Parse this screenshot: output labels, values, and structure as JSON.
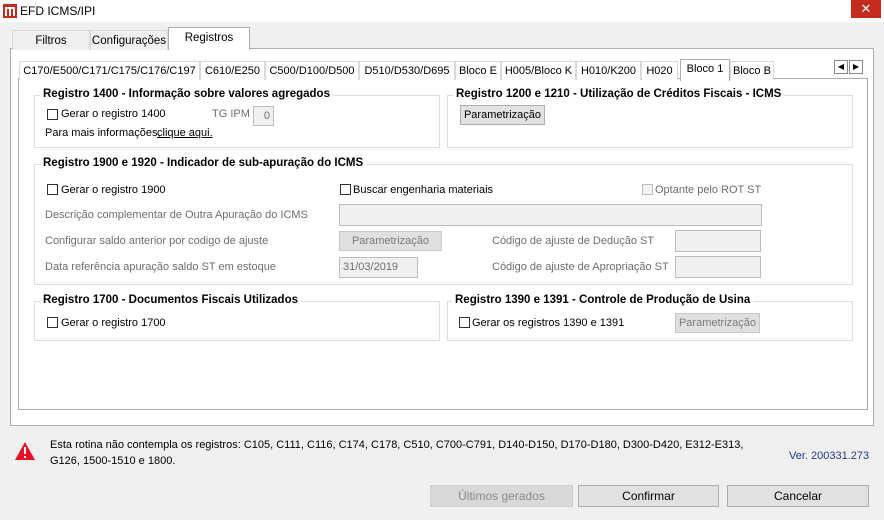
{
  "window": {
    "title": "EFD ICMS/IPI",
    "close_glyph": "✕"
  },
  "tabs": [
    {
      "label": "Filtros"
    },
    {
      "label": "Configurações"
    },
    {
      "label": "Registros"
    }
  ],
  "subtabs": [
    {
      "label": "C170/E500/C171/C175/C176/C197"
    },
    {
      "label": "C610/E250"
    },
    {
      "label": "C500/D100/D500"
    },
    {
      "label": "D510/D530/D695"
    },
    {
      "label": "Bloco E"
    },
    {
      "label": "H005/Bloco K"
    },
    {
      "label": "H010/K200"
    },
    {
      "label": "H020"
    },
    {
      "label": "Bloco 1"
    },
    {
      "label": "Bloco B"
    }
  ],
  "scroll": {
    "left": "◀",
    "right": "▶"
  },
  "g1400": {
    "title": "Registro 1400 - Informação sobre valores agregados",
    "checkbox_label": "Gerar o registro 1400",
    "tg_ipm_label": "TG IPM",
    "tg_ipm_value": "0",
    "info_prefix": "Para mais informações,",
    "info_link": "clique aqui."
  },
  "g1200": {
    "title": "Registro 1200 e 1210 - Utilização de Créditos Fiscais - ICMS",
    "button": "Parametrização"
  },
  "g1900": {
    "title": "Registro 1900 e 1920 - Indicador de sub-apuração do ICMS",
    "cb_1900": "Gerar o registro 1900",
    "cb_buscar": "Buscar engenharia materiais",
    "cb_optante": "Optante pelo ROT ST",
    "desc_label": "Descrição complementar de Outra Apuração do ICMS",
    "desc_value": "",
    "saldo_label": "Configurar saldo anterior por codigo de ajuste",
    "saldo_button": "Parametrização",
    "data_label": "Data referência apuração saldo ST em estoque",
    "data_value": "31/03/2019",
    "deducao_label": "Código de ajuste de Dedução ST",
    "deducao_value": "",
    "apropriacao_label": "Código de ajuste de Apropriação ST",
    "apropriacao_value": ""
  },
  "g1700": {
    "title": "Registro 1700 - Documentos Fiscais Utilizados",
    "checkbox_label": "Gerar o registro 1700"
  },
  "g1390": {
    "title": "Registro 1390 e 1391 - Controle de Produção de Usina",
    "checkbox_label": "Gerar os registros 1390 e 1391",
    "button": "Parametrização"
  },
  "warning": {
    "line1": "Esta rotina não contempla os registros: C105, C111, C116, C174, C178, C510, C700-C791, D140-D150, D170-D180, D300-D420, E312-E313,",
    "line2": "G126, 1500-1510 e 1800.",
    "version": "Ver. 200331.273",
    "icon_color": "#e81123"
  },
  "footer": {
    "ultimos": "Últimos gerados",
    "confirmar": "Confirmar",
    "cancelar": "Cancelar"
  }
}
